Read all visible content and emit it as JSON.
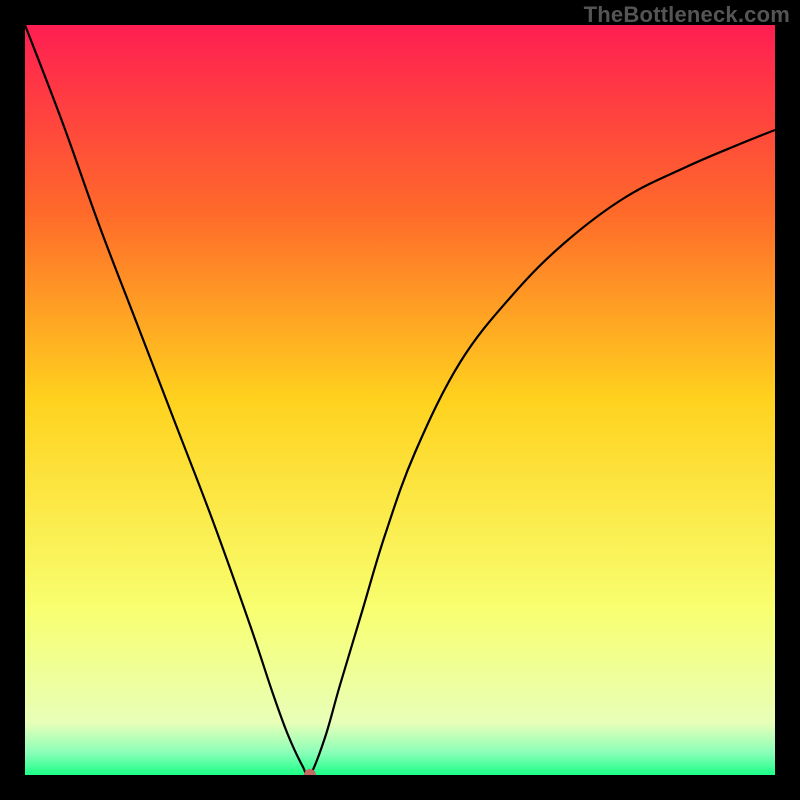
{
  "watermark": "TheBottleneck.com",
  "chart_data": {
    "type": "line",
    "title": "",
    "xlabel": "",
    "ylabel": "",
    "xlim": [
      0,
      100
    ],
    "ylim": [
      0,
      100
    ],
    "gradient_stops": [
      {
        "offset": 0.0,
        "color": "#ff1e52"
      },
      {
        "offset": 0.25,
        "color": "#ff6a2a"
      },
      {
        "offset": 0.5,
        "color": "#ffd21e"
      },
      {
        "offset": 0.78,
        "color": "#f8ff70"
      },
      {
        "offset": 0.93,
        "color": "#e8ffb8"
      },
      {
        "offset": 0.97,
        "color": "#8bffb8"
      },
      {
        "offset": 1.0,
        "color": "#1bff87"
      }
    ],
    "series": [
      {
        "name": "bottleneck-curve",
        "x": [
          0,
          5,
          10,
          15,
          20,
          25,
          30,
          33,
          35,
          37,
          38,
          40,
          42,
          45,
          48,
          52,
          58,
          65,
          72,
          80,
          88,
          95,
          100
        ],
        "y": [
          100,
          87,
          73,
          60,
          47,
          34,
          20,
          11,
          5.5,
          1.2,
          0,
          5,
          12,
          22,
          32,
          43,
          55,
          64,
          71,
          77,
          81,
          84,
          86
        ]
      }
    ],
    "marker": {
      "x": 38,
      "y": 0,
      "color": "#c46a63",
      "r": 6
    }
  }
}
